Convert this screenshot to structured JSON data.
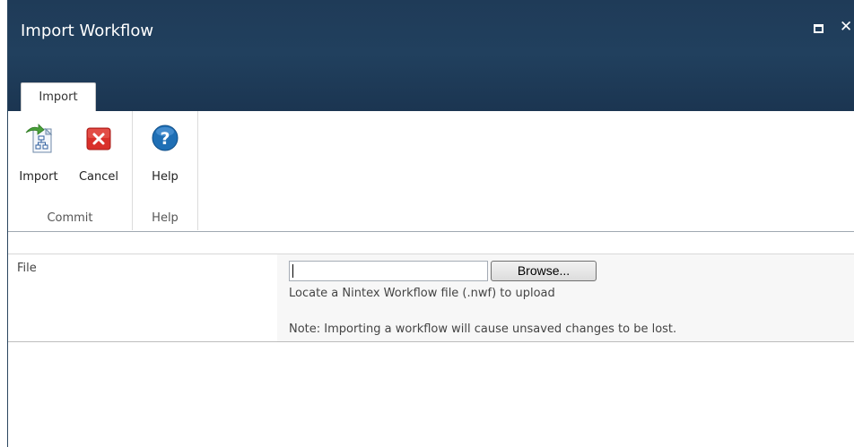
{
  "dialog": {
    "title": "Import Workflow",
    "close_glyph": "✕"
  },
  "ribbon": {
    "tab_label": "Import",
    "groups": [
      {
        "label": "Commit",
        "buttons": [
          {
            "label": "Import",
            "icon": "import-workflow-icon"
          },
          {
            "label": "Cancel",
            "icon": "cancel-icon"
          }
        ]
      },
      {
        "label": "Help",
        "buttons": [
          {
            "label": "Help",
            "icon": "help-icon"
          }
        ]
      }
    ]
  },
  "form": {
    "file_label": "File",
    "file_value": "",
    "browse_label": "Browse...",
    "hint": "Locate a Nintex Workflow file (.nwf) to upload",
    "note": "Note: Importing a workflow will cause unsaved changes to be lost."
  },
  "colors": {
    "titlebar": "#1f3b58",
    "cancel_red": "#d9302a",
    "help_blue": "#1f6fb5"
  }
}
